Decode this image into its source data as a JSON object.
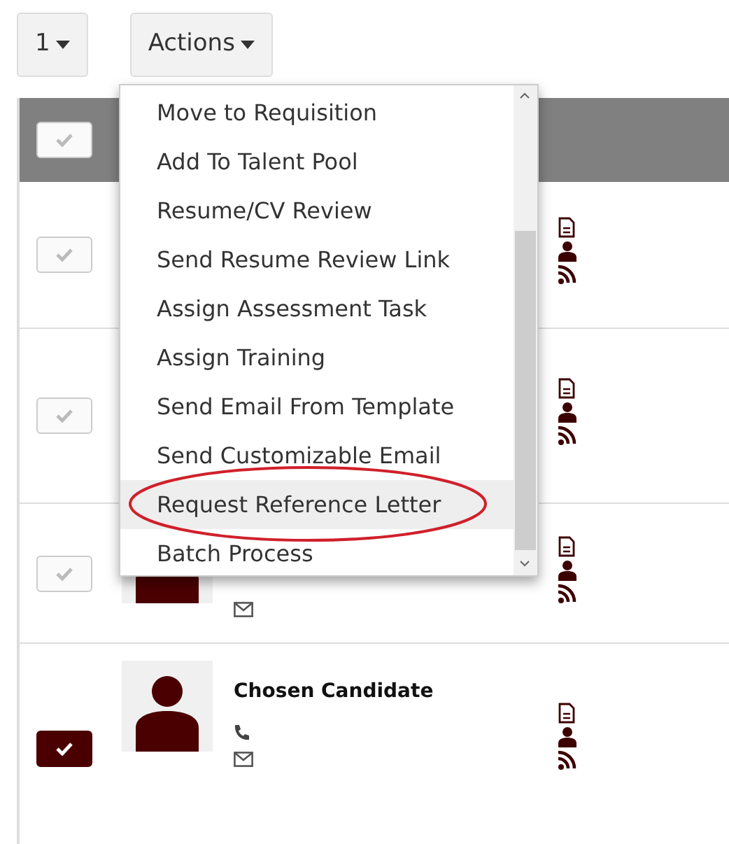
{
  "toolbar": {
    "page_button": "1",
    "actions_button": "Actions"
  },
  "header": {
    "checked": false
  },
  "rows": [
    {
      "checked": false,
      "contact": false
    },
    {
      "checked": false,
      "contact": false
    },
    {
      "checked": false,
      "contact": true
    },
    {
      "checked": true,
      "contact": true,
      "name": "Chosen Candidate"
    }
  ],
  "actions_menu": {
    "items": [
      {
        "label": "Move to Requisition",
        "highlighted": false,
        "circled": false
      },
      {
        "label": "Add To Talent Pool",
        "highlighted": false,
        "circled": false
      },
      {
        "label": "Resume/CV Review",
        "highlighted": false,
        "circled": false
      },
      {
        "label": "Send Resume Review Link",
        "highlighted": false,
        "circled": false
      },
      {
        "label": "Assign Assessment Task",
        "highlighted": false,
        "circled": false
      },
      {
        "label": "Assign Training",
        "highlighted": false,
        "circled": false
      },
      {
        "label": "Send Email From Template",
        "highlighted": false,
        "circled": false
      },
      {
        "label": "Send Customizable Email",
        "highlighted": false,
        "circled": false
      },
      {
        "label": "Request Reference Letter",
        "highlighted": true,
        "circled": true
      },
      {
        "label": "Batch Process",
        "highlighted": false,
        "circled": false
      }
    ]
  }
}
